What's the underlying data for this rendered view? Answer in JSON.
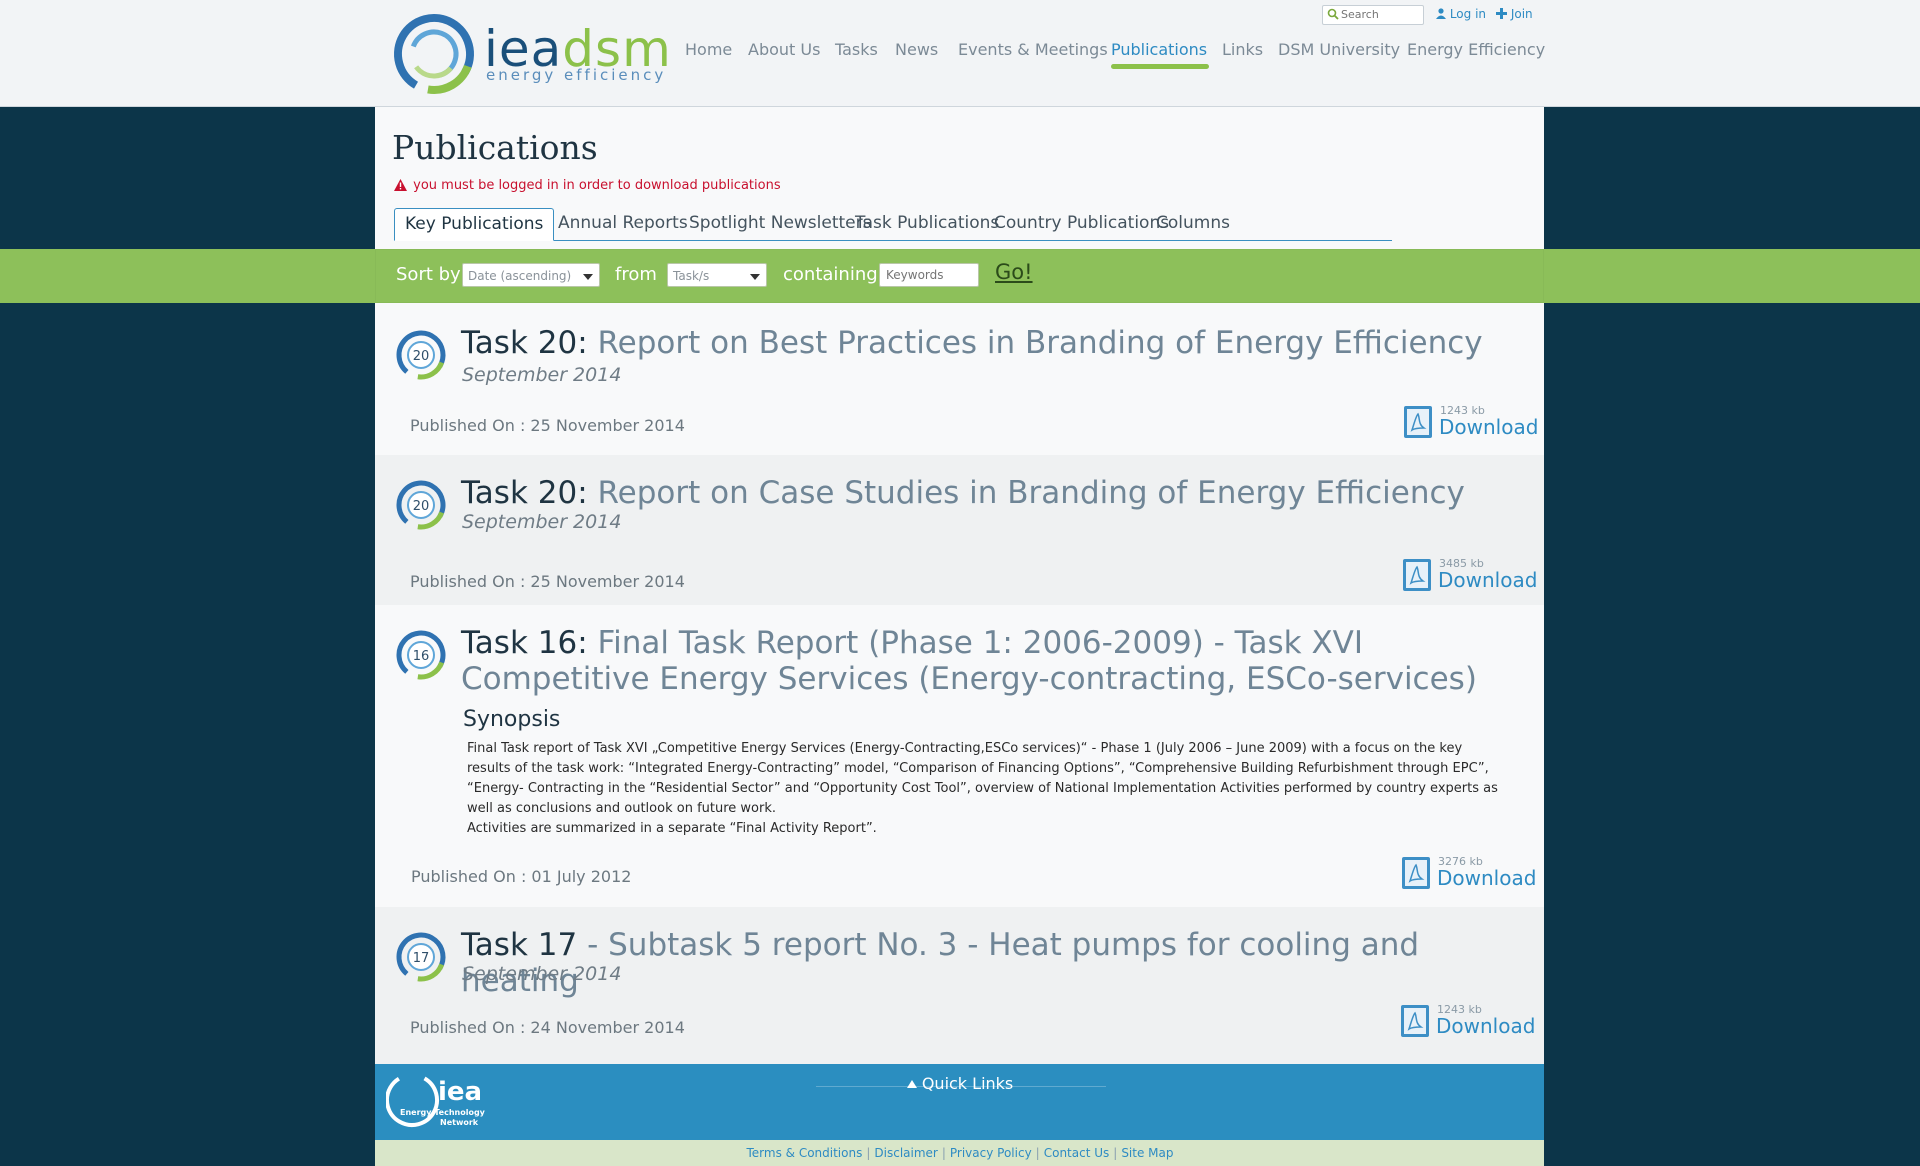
{
  "header": {
    "logo": {
      "main_a": "iea",
      "main_b": "dsm",
      "sub": "energy efficiency"
    },
    "search": {
      "placeholder": "Search"
    },
    "login_label": "Log in",
    "join_label": "Join",
    "nav": [
      "Home",
      "About Us",
      "Tasks",
      "News",
      "Events & Meetings",
      "Publications",
      "Links",
      "DSM University",
      "Energy Efficiency"
    ],
    "active_nav": "Publications"
  },
  "page": {
    "title": "Publications",
    "login_warning": "you must be logged in in order to download publications",
    "tabs": [
      "Key Publications",
      "Annual Reports",
      "Spotlight Newsletters",
      "Task Publications",
      "Country Publications",
      "Columns"
    ],
    "active_tab": "Key Publications"
  },
  "filter": {
    "sort_by_label": "Sort by",
    "sort_value": "Date (ascending)",
    "from_label": "from",
    "from_value": "Task/s",
    "containing_label": "containing",
    "keywords_placeholder": "Keywords",
    "go_label": "Go!"
  },
  "publications": [
    {
      "badge": "20",
      "task": "Task 20:",
      "title": "Report on Best Practices in Branding of Energy Efficiency",
      "date": "September 2014",
      "published": "Published On : 25 November 2014",
      "size": "1243 kb",
      "download": "Download"
    },
    {
      "badge": "20",
      "task": "Task 20:",
      "title": "Report on Case Studies in Branding of Energy Efficiency",
      "date": "September 2014",
      "published": "Published On : 25 November 2014",
      "size": "3485 kb",
      "download": "Download"
    },
    {
      "badge": "16",
      "task": "Task 16:",
      "title": "Final Task Report (Phase 1: 2006-2009) - Task XVI Competitive Energy Services (Energy-contracting, ESCo-services)",
      "synopsis_heading": "Synopsis",
      "synopsis_p1": "Final Task report of Task XVI „Competitive Energy Services (Energy-Contracting,ESCo services)“ - Phase 1 (July 2006 – June 2009) with a focus on the key results of the task work: “Integrated Energy-Contracting” model, “Comparison of Financing Options”, “Comprehensive Building Refurbishment through EPC”, “Energy- Contracting in the “Residential Sector” and “Opportunity Cost Tool”, overview of National Implementation Activities performed by country experts as well as conclusions and outlook on future work.",
      "synopsis_p2": "Activities are summarized in a separate “Final Activity Report”.",
      "published": "Published On : 01 July 2012",
      "size": "3276 kb",
      "download": "Download"
    },
    {
      "badge": "17",
      "task": "Task 17",
      "title": " - Subtask 5 report No. 3 - Heat pumps for cooling and heating",
      "date": "September 2014",
      "published": "Published On : 24 November 2014",
      "size": "1243 kb",
      "download": "Download"
    }
  ],
  "footer": {
    "quick_links": "Quick Links",
    "iea_logo": {
      "word": "iea",
      "line1": "Energy Technology",
      "line2": "Network"
    },
    "links": [
      "Terms & Conditions",
      "Disclaimer",
      "Privacy Policy",
      "Contact Us",
      "Site Map"
    ]
  },
  "colors": {
    "background": "#0c3549",
    "accent_green": "#8dc05a",
    "accent_blue": "#2e8bc3",
    "warning_red": "#c8102e"
  }
}
